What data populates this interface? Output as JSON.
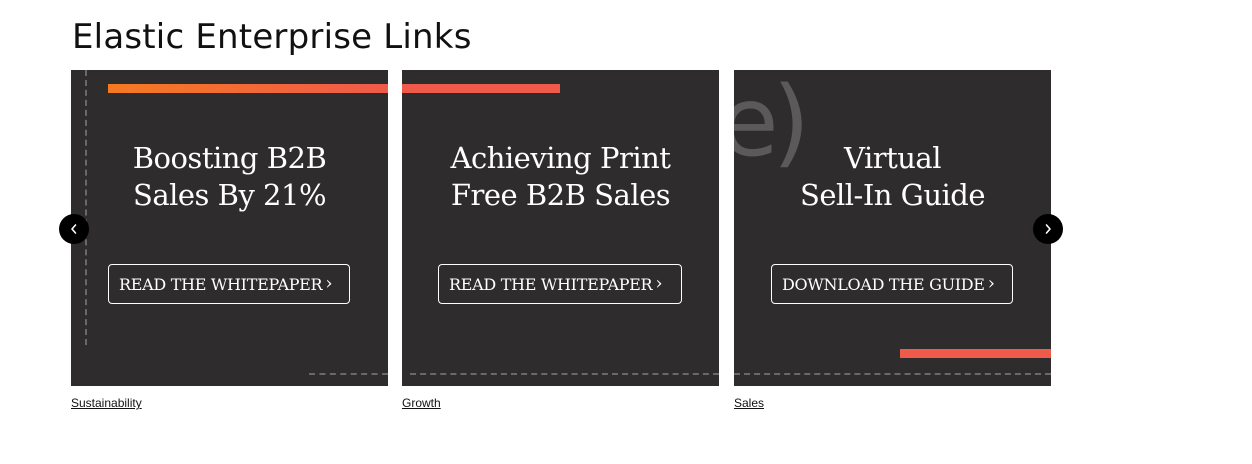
{
  "page": {
    "title": "Elastic Enterprise Links"
  },
  "colors": {
    "tile_background": "#2e2c2d",
    "accent_orange": "#f47a22",
    "accent_coral": "#f05a4a",
    "link_text": "#111111",
    "nav_button": "#000000"
  },
  "carousel": {
    "prev_icon": "chevron-left-icon",
    "next_icon": "chevron-right-icon",
    "cards": [
      {
        "heading_line1": "Boosting B2B",
        "heading_line2": "Sales By 21%",
        "cta_label": "READ THE WHITEPAPER",
        "cta_icon": "chevron-right-icon",
        "link_label": "Sustainability"
      },
      {
        "heading_line1": "Achieving Print",
        "heading_line2": "Free B2B Sales",
        "cta_label": "READ THE WHITEPAPER",
        "cta_icon": "chevron-right-icon",
        "link_label": "Growth"
      },
      {
        "heading_line1": "Virtual",
        "heading_line2": "Sell-In Guide",
        "cta_label": "DOWNLOAD THE GUIDE",
        "cta_icon": "chevron-right-icon",
        "link_label": "Sales"
      }
    ]
  }
}
